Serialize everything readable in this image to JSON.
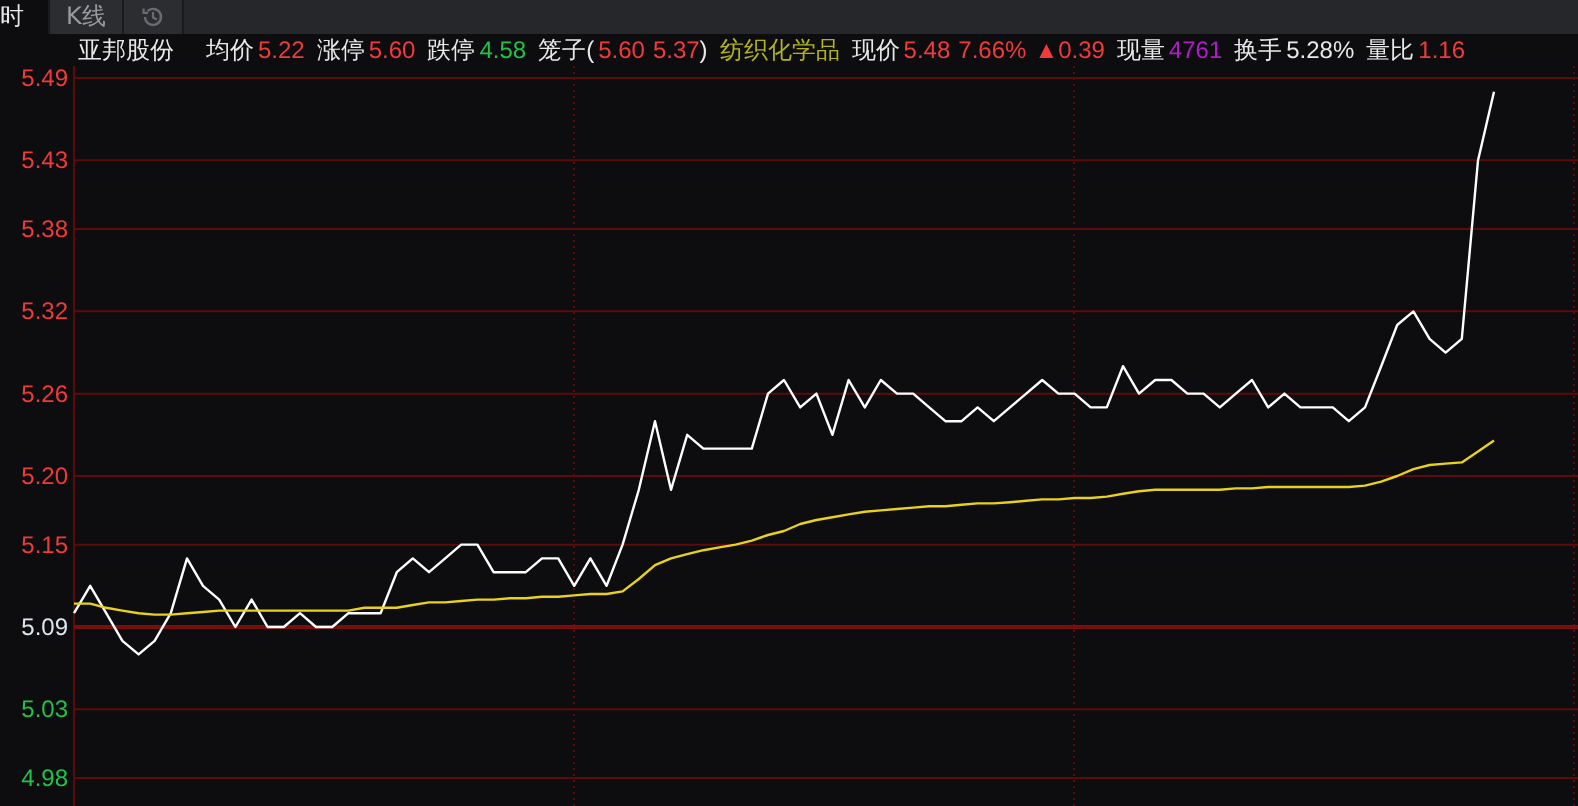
{
  "tabs": [
    {
      "label": "时",
      "kind": "text",
      "selected": true
    },
    {
      "label": "K线",
      "kind": "text",
      "selected": false
    },
    {
      "kind": "icon",
      "selected": false
    }
  ],
  "info": {
    "name": "亚邦股份",
    "items": [
      {
        "kind": "pair",
        "label": "均价",
        "values": [
          "5.22"
        ],
        "color": "#f23a3a"
      },
      {
        "kind": "pair",
        "label": "涨停",
        "values": [
          "5.60"
        ],
        "color": "#f23a3a"
      },
      {
        "kind": "pair",
        "label": "跌停",
        "values": [
          "4.58"
        ],
        "color": "#1fc24a"
      },
      {
        "kind": "pair",
        "label": "笼子(",
        "values": [
          "5.60",
          "5.37"
        ],
        "suffix": ")",
        "color": "#f23a3a"
      },
      {
        "kind": "tag",
        "label": "纺织化学品",
        "color": "#b3b31a"
      },
      {
        "kind": "pair",
        "label": "现价",
        "values": [
          "5.48",
          "7.66%",
          "▲0.39"
        ],
        "color": "#f23a3a"
      },
      {
        "kind": "pair",
        "label": "现量",
        "values": [
          "4761"
        ],
        "color": "#b01cc8"
      },
      {
        "kind": "pair",
        "label": "换手",
        "values": [
          "5.28%"
        ],
        "color": "#e8e8e8"
      },
      {
        "kind": "pair",
        "label": "量比",
        "values": [
          "1.16"
        ],
        "color": "#f23a3a"
      }
    ]
  },
  "chart_data": {
    "type": "line",
    "ylim": [
      4.98,
      5.49
    ],
    "grid": true,
    "yticks": [
      5.49,
      5.43,
      5.38,
      5.32,
      5.26,
      {
        "value": 5.2,
        "label": "5.20"
      },
      5.15,
      5.09,
      5.03,
      4.98
    ],
    "ref_lines": [
      {
        "axis": "y",
        "value": 5.09
      }
    ],
    "series": [
      {
        "color": "#ffffff",
        "values": [
          5.1,
          5.12,
          5.1,
          5.08,
          5.07,
          5.08,
          5.1,
          5.14,
          5.12,
          5.11,
          5.09,
          5.11,
          5.09,
          5.09,
          5.1,
          5.09,
          5.09,
          5.1,
          5.1,
          5.1,
          5.13,
          5.14,
          5.13,
          5.14,
          5.15,
          5.15,
          5.13,
          5.13,
          5.13,
          5.14,
          5.14,
          5.12,
          5.14,
          5.12,
          5.15,
          5.19,
          5.24,
          5.19,
          5.23,
          5.22,
          5.22,
          5.22,
          5.22,
          5.26,
          5.27,
          5.25,
          5.26,
          5.23,
          5.27,
          5.25,
          5.27,
          5.26,
          5.26,
          5.25,
          5.24,
          5.24,
          5.25,
          5.24,
          5.25,
          5.26,
          5.27,
          5.26,
          5.26,
          5.25,
          5.25,
          5.28,
          5.26,
          5.27,
          5.27,
          5.26,
          5.26,
          5.25,
          5.26,
          5.27,
          5.25,
          5.26,
          5.25,
          5.25,
          5.25,
          5.24,
          5.25,
          5.28,
          5.31,
          5.32,
          5.3,
          5.29,
          5.3,
          5.43,
          5.48
        ]
      },
      {
        "color": "#e8d21d",
        "values": [
          5.107,
          5.107,
          5.104,
          5.102,
          5.1,
          5.099,
          5.099,
          5.1,
          5.101,
          5.102,
          5.102,
          5.102,
          5.102,
          5.102,
          5.102,
          5.102,
          5.102,
          5.102,
          5.104,
          5.104,
          5.104,
          5.106,
          5.108,
          5.108,
          5.109,
          5.11,
          5.11,
          5.111,
          5.111,
          5.112,
          5.112,
          5.113,
          5.114,
          5.114,
          5.116,
          5.125,
          5.135,
          5.14,
          5.143,
          5.146,
          5.148,
          5.15,
          5.153,
          5.157,
          5.16,
          5.165,
          5.168,
          5.17,
          5.172,
          5.174,
          5.175,
          5.176,
          5.177,
          5.178,
          5.178,
          5.179,
          5.18,
          5.18,
          5.181,
          5.182,
          5.183,
          5.183,
          5.184,
          5.184,
          5.185,
          5.187,
          5.189,
          5.19,
          5.19,
          5.19,
          5.19,
          5.19,
          5.191,
          5.191,
          5.192,
          5.192,
          5.192,
          5.192,
          5.192,
          5.192,
          5.193,
          5.196,
          5.2,
          5.205,
          5.208,
          5.209,
          5.21,
          5.218,
          5.226
        ]
      }
    ]
  }
}
